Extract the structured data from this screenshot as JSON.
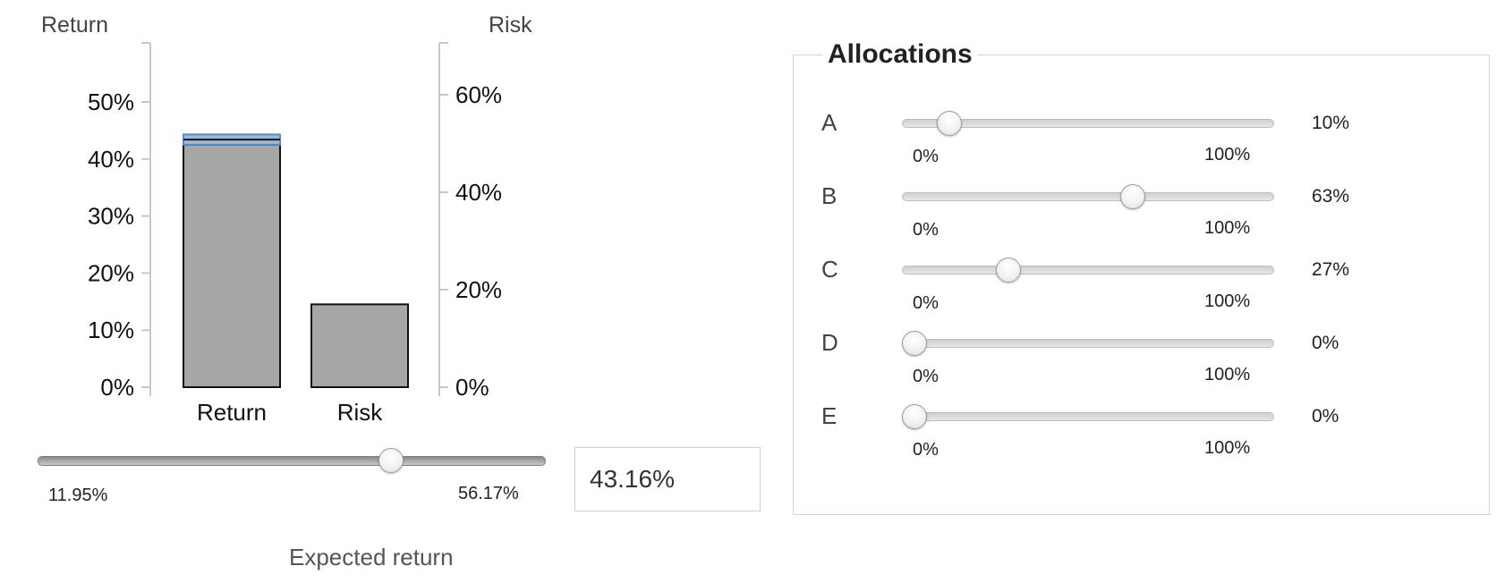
{
  "chart_data": {
    "type": "bar",
    "categories": [
      "Return",
      "Risk"
    ],
    "left_axis": {
      "title": "Return",
      "ticks": [
        "0%",
        "10%",
        "20%",
        "30%",
        "40%",
        "50%"
      ],
      "ylim": [
        0,
        60
      ]
    },
    "right_axis": {
      "title": "Risk",
      "ticks": [
        "0%",
        "20%",
        "40%",
        "60%"
      ],
      "ylim": [
        0,
        70
      ]
    },
    "values": [
      42.5,
      17
    ],
    "highlight": {
      "category": "Return",
      "low": 42.5,
      "high": 44.3,
      "color": "#4f8fd0"
    },
    "bar_color": "#a6a6a6"
  },
  "expected_return": {
    "caption": "Expected return",
    "min_label": "11.95%",
    "max_label": "56.17%",
    "min": 11.95,
    "max": 56.17,
    "value": 43.16,
    "display": "43.16%"
  },
  "allocations": {
    "title": "Allocations",
    "rows": [
      {
        "letter": "A",
        "value": 10,
        "display": "10%",
        "min_label": "0%",
        "max_label": "100%"
      },
      {
        "letter": "B",
        "value": 63,
        "display": "63%",
        "min_label": "0%",
        "max_label": "100%"
      },
      {
        "letter": "C",
        "value": 27,
        "display": "27%",
        "min_label": "0%",
        "max_label": "100%"
      },
      {
        "letter": "D",
        "value": 0,
        "display": "0%",
        "min_label": "0%",
        "max_label": "100%"
      },
      {
        "letter": "E",
        "value": 0,
        "display": "0%",
        "min_label": "0%",
        "max_label": "100%"
      }
    ]
  }
}
